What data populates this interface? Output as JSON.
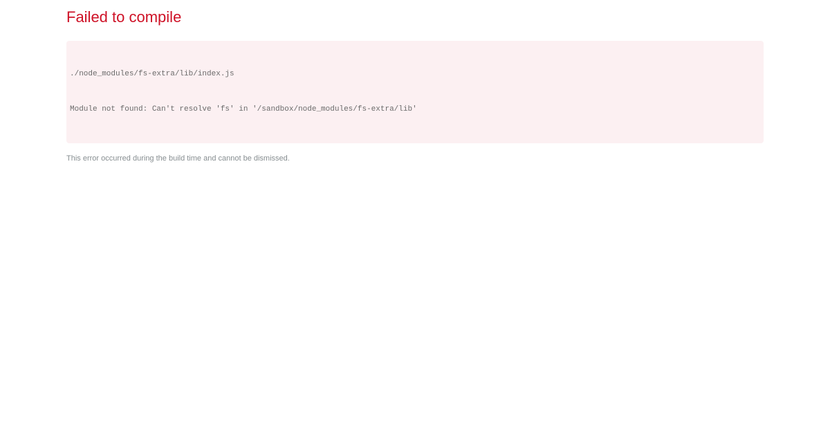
{
  "error_overlay": {
    "title": "Failed to compile",
    "code_lines": [
      "./node_modules/fs-extra/lib/index.js",
      "Module not found: Can't resolve 'fs' in '/sandbox/node_modules/fs-extra/lib'"
    ],
    "footer": "This error occurred during the build time and cannot be dismissed."
  },
  "colors": {
    "title": "#ce1126",
    "code_background": "#fcf0f2",
    "code_text": "#6b6b6b",
    "footer_text": "#878e91"
  }
}
